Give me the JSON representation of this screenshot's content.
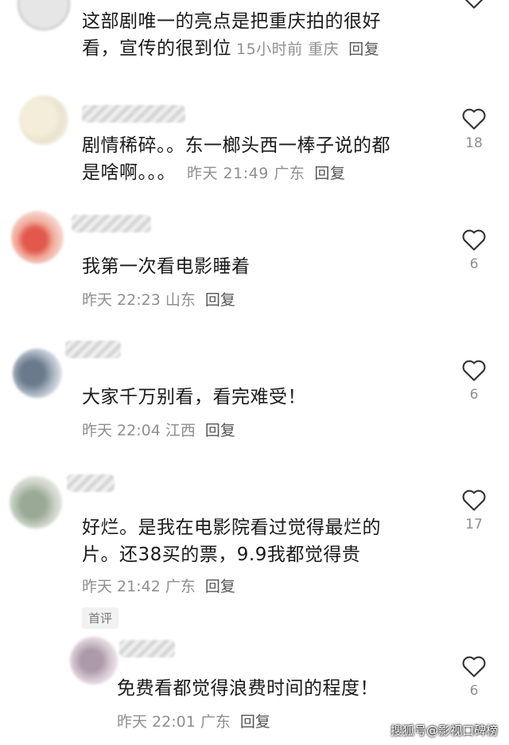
{
  "comments": [
    {
      "text_lines": [
        "这部剧唯一的亮点是把重庆拍的很好",
        "看，宣传的很到位"
      ],
      "time": "15小时前",
      "location": "重庆",
      "reply": "回复",
      "likes": ""
    },
    {
      "text_lines": [
        "剧情稀碎。。东一榔头西一棒子说的都",
        "是啥啊。。。"
      ],
      "time": "昨天 21:49",
      "location": "广东",
      "reply": "回复",
      "likes": "18"
    },
    {
      "text_lines": [
        "我第一次看电影睡着"
      ],
      "time": "昨天 22:23",
      "location": "山东",
      "reply": "回复",
      "likes": "6"
    },
    {
      "text_lines": [
        "大家千万别看，看完难受！"
      ],
      "time": "昨天 22:04",
      "location": "江西",
      "reply": "回复",
      "likes": "6"
    },
    {
      "text_lines": [
        "好烂。是我在电影院看过觉得最烂的",
        "片。还38买的票，9.9我都觉得贵"
      ],
      "time": "昨天 21:42",
      "location": "广东",
      "reply": "回复",
      "likes": "17",
      "tag": "首评"
    },
    {
      "text_lines": [
        "免费看都觉得浪费时间的程度！"
      ],
      "time": "昨天 22:01",
      "location": "广东",
      "reply": "回复",
      "likes": "6"
    }
  ],
  "watermark": "搜狐号@影视口碑榜",
  "colors": {
    "text": "#1a1a1a",
    "meta": "#8f8f8f",
    "icon": "#333333"
  }
}
